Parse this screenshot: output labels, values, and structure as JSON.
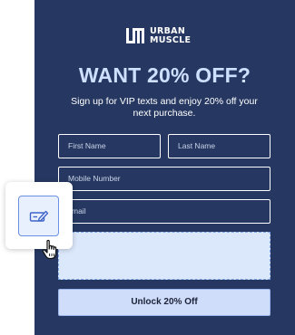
{
  "brand": {
    "line1": "URBAN",
    "line2": "MUSCLE"
  },
  "headline": "WANT 20% OFF?",
  "subtext": "Sign up for VIP texts and enjoy 20% off your next purchase.",
  "form": {
    "first_name_placeholder": "First Name",
    "last_name_placeholder": "Last Name",
    "mobile_placeholder": "Mobile Number",
    "email_placeholder": "mail",
    "submit_label": "Unlock 20% Off"
  },
  "icons": {
    "edit": "edit-form-icon",
    "cursor": "hand-pointer-icon"
  },
  "colors": {
    "panel_bg": "#263861",
    "headline": "#cfe0ff",
    "button_bg": "#cfdcfa",
    "drop_zone_bg": "#dbe7fb",
    "accent": "#6b8fe3"
  }
}
